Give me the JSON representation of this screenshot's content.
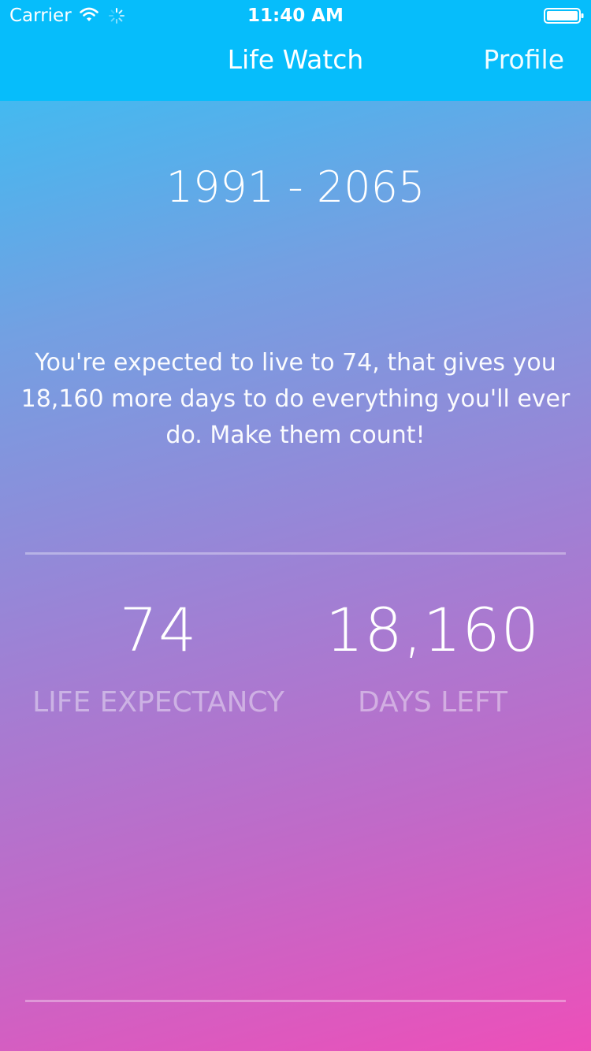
{
  "status_bar": {
    "carrier": "Carrier",
    "time": "11:40 AM",
    "icons": [
      "wifi-icon",
      "activity-spinner-icon",
      "battery-icon"
    ]
  },
  "nav": {
    "title": "Life Watch",
    "profile_label": "Profile"
  },
  "summary": {
    "years": "1991 - 2065",
    "message": "You're expected to live to 74, that gives you 18,160 more days to do everything you'll ever do. Make them count!"
  },
  "stats": {
    "life_expectancy": {
      "value": "74",
      "label": "Life Expectancy"
    },
    "days_left": {
      "value": "18,160",
      "label": "Days Left"
    }
  },
  "colors": {
    "nav_background": "#06bdfb",
    "gradient_top": "#2fc4f6",
    "gradient_bottom": "#ed4fb9",
    "text": "#ffffff"
  }
}
